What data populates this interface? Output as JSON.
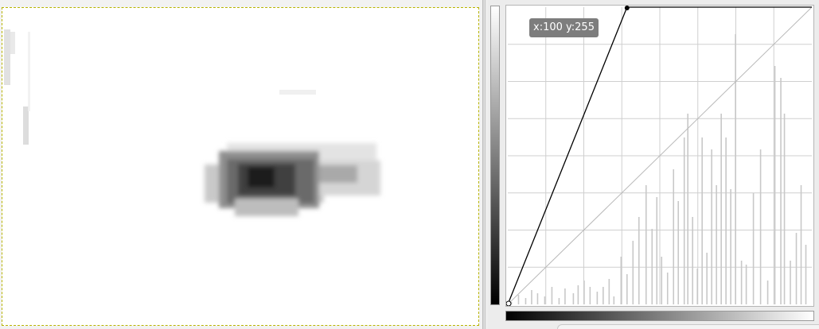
{
  "window": {
    "canvas_label": "image-canvas",
    "panel_label": "curves"
  },
  "curves": {
    "readout": "x:100 y:255",
    "range": [
      0,
      255
    ],
    "curve_points": [
      [
        0,
        0
      ],
      [
        100,
        255
      ],
      [
        255,
        255
      ]
    ],
    "grid_divisions": 8,
    "colors": {
      "curve": "#000000",
      "diagonal": "#b9b9b9",
      "grid": "#cfcfcf",
      "histogram": "#c8c8c8",
      "selection_border": "#b7b300"
    },
    "histogram": [
      [
        6,
        3
      ],
      [
        18,
        12
      ],
      [
        30,
        8
      ],
      [
        40,
        18
      ],
      [
        50,
        14
      ],
      [
        62,
        10
      ],
      [
        74,
        22
      ],
      [
        86,
        8
      ],
      [
        96,
        20
      ],
      [
        110,
        14
      ],
      [
        118,
        24
      ],
      [
        128,
        30
      ],
      [
        138,
        22
      ],
      [
        150,
        16
      ],
      [
        160,
        22
      ],
      [
        170,
        32
      ],
      [
        178,
        10
      ],
      [
        190,
        60
      ],
      [
        200,
        38
      ],
      [
        210,
        80
      ],
      [
        220,
        110
      ],
      [
        232,
        150
      ],
      [
        242,
        95
      ],
      [
        250,
        135
      ],
      [
        258,
        60
      ],
      [
        268,
        40
      ],
      [
        278,
        170
      ],
      [
        286,
        130
      ],
      [
        296,
        210
      ],
      [
        302,
        240
      ],
      [
        310,
        110
      ],
      [
        318,
        45
      ],
      [
        326,
        210
      ],
      [
        334,
        65
      ],
      [
        342,
        195
      ],
      [
        350,
        150
      ],
      [
        358,
        240
      ],
      [
        366,
        210
      ],
      [
        374,
        145
      ],
      [
        382,
        340
      ],
      [
        392,
        55
      ],
      [
        400,
        50
      ],
      [
        412,
        140
      ],
      [
        424,
        195
      ],
      [
        436,
        30
      ],
      [
        448,
        300
      ],
      [
        458,
        285
      ],
      [
        464,
        240
      ],
      [
        474,
        55
      ],
      [
        484,
        90
      ],
      [
        492,
        150
      ],
      [
        500,
        75
      ]
    ]
  }
}
